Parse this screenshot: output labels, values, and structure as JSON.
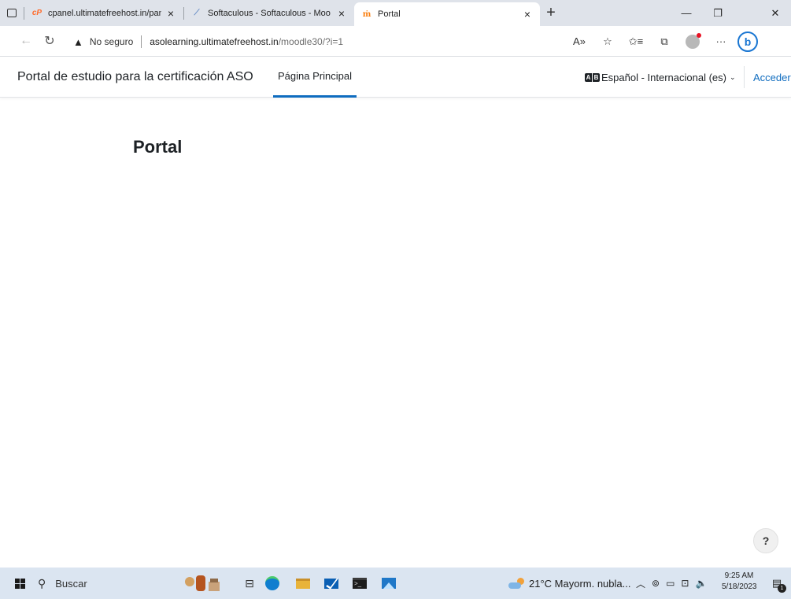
{
  "browser": {
    "tabs": [
      {
        "title": "cpanel.ultimatefreehost.in/panel/",
        "favicon": "cpanel-icon",
        "active": false
      },
      {
        "title": "Softaculous - Softaculous - Moo",
        "favicon": "softaculous-icon",
        "active": false
      },
      {
        "title": "Portal",
        "favicon": "moodle-icon",
        "active": true
      }
    ],
    "security_label": "No seguro",
    "url_host": "asolearning.ultimatefreehost.in",
    "url_path": "/moodle30/?i=1"
  },
  "navbar": {
    "brand": "Portal de estudio para la certificación ASO",
    "home_link": "Página Principal",
    "language": "Español - Internacional (es)",
    "language_icon_text": [
      "A",
      "B"
    ],
    "login": "Acceder"
  },
  "page": {
    "heading": "Portal",
    "help_label": "?"
  },
  "taskbar": {
    "search_label": "Buscar",
    "weather": "21°C  Mayorm. nubla...",
    "time": "9:25 AM",
    "date": "5/18/2023",
    "notification_count": "1"
  },
  "colors": {
    "accent": "#0f6cbf",
    "taskbar_bg": "#dbe5f1",
    "tabstrip_bg": "#dfe3ea"
  }
}
